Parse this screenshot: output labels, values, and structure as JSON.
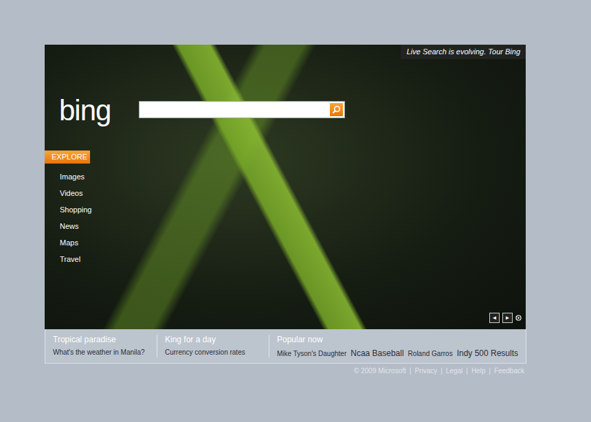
{
  "banner": {
    "text": "Live Search is evolving. Tour Bing"
  },
  "logo": {
    "text": "bing"
  },
  "explore": {
    "label": "EXPLORE"
  },
  "nav": [
    "Images",
    "Videos",
    "Shopping",
    "News",
    "Maps",
    "Travel"
  ],
  "carousel": {
    "prev": "◄",
    "next": "►"
  },
  "sections": [
    {
      "title": "Tropical paradise",
      "links": [
        {
          "text": "What's the weather in Manila?",
          "kind": "small"
        }
      ]
    },
    {
      "title": "King for a day",
      "links": [
        {
          "text": "Currency conversion rates",
          "kind": "small"
        }
      ]
    },
    {
      "title": "Popular now",
      "links": [
        {
          "text": "Mike Tyson's Daughter",
          "kind": "small"
        },
        {
          "text": "Ncaa Baseball",
          "kind": "large"
        },
        {
          "text": "Roland Garros",
          "kind": "small"
        },
        {
          "text": "Indy 500 Results",
          "kind": "large"
        }
      ]
    }
  ],
  "footer": {
    "copyright": "© 2009 Microsoft",
    "separator": "|",
    "links": [
      "Privacy",
      "Legal",
      "Help",
      "Feedback"
    ]
  }
}
